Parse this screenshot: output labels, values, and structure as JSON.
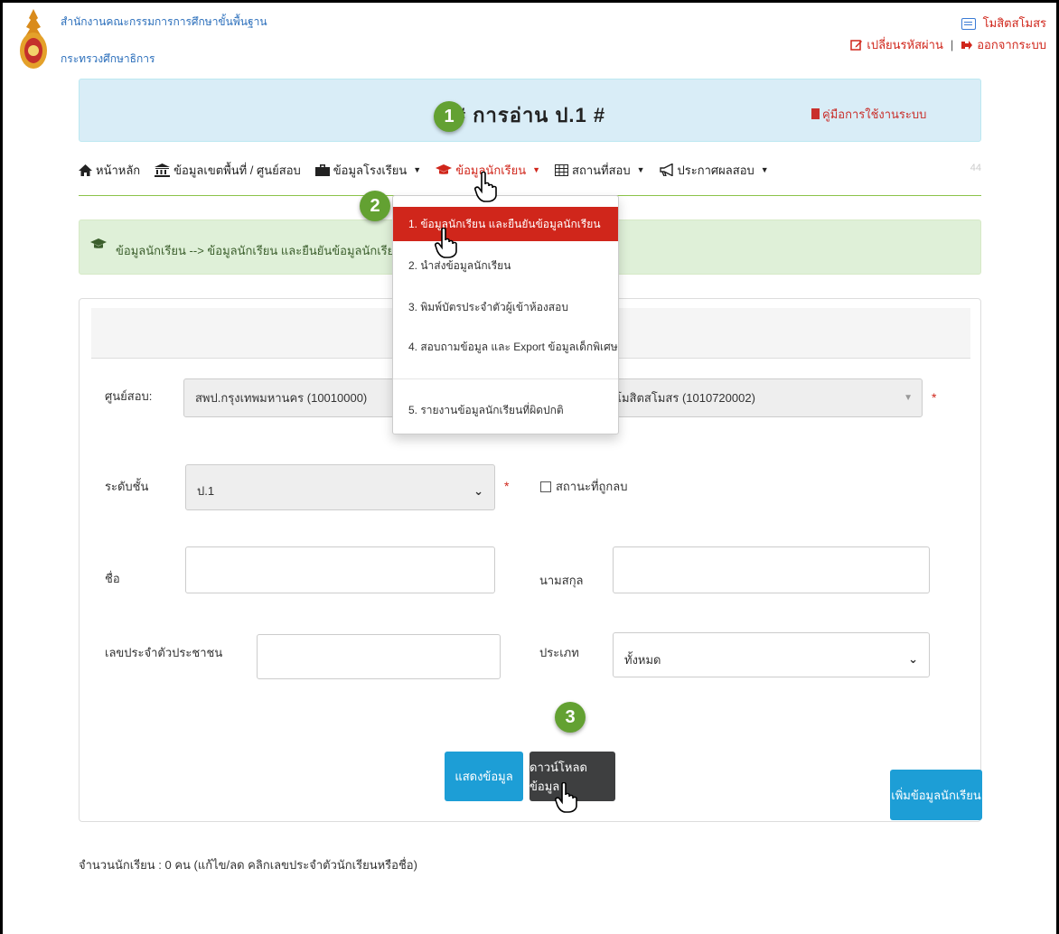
{
  "header": {
    "org_line1": "สำนักงานคณะกรรมการการศึกษาขั้นพื้นฐาน",
    "org_line2": "กระทรวงศึกษาธิการ",
    "user_name": "โมสิตสโมสร",
    "change_password": "เปลี่ยนรหัสผ่าน",
    "logout": "ออกจากระบบ",
    "separator": "|"
  },
  "banner": {
    "title": "# การอ่าน ป.1 #",
    "manual_link": "คู่มือการใช้งานระบบ"
  },
  "nav": {
    "items": [
      {
        "label": "หน้าหลัก",
        "icon": "home-icon"
      },
      {
        "label": "ข้อมูลเขตพื้นที่ / ศูนย์สอบ",
        "icon": "institution-icon"
      },
      {
        "label": "ข้อมูลโรงเรียน",
        "icon": "briefcase-icon"
      },
      {
        "label": "ข้อมูลนักเรียน",
        "icon": "graduation-cap-icon"
      },
      {
        "label": "สถานที่สอบ",
        "icon": "table-icon"
      },
      {
        "label": "ประกาศผลสอบ",
        "icon": "bullhorn-icon"
      }
    ],
    "count": "44"
  },
  "breadcrumb": "ข้อมูลนักเรียน --> ข้อมูลนักเรียน และยืนยันข้อมูลนักเรียน",
  "dropdown": {
    "items": [
      "1. ข้อมูลนักเรียน และยืนยันข้อมูลนักเรียน",
      "2. นำส่งข้อมูลนักเรียน",
      "3. พิมพ์บัตรประจำตัวผู้เข้าห้องสอบ",
      "4. สอบถามข้อมูล และ Export ข้อมูลเด็กพิเศษ",
      "5. รายงานข้อมูลนักเรียนที่ผิดปกติ"
    ]
  },
  "form": {
    "center_label": "ศูนย์สอบ:",
    "center_value": "สพป.กรุงเทพมหานคร (10010000)",
    "school_value": "โมสิตสโมสร (1010720002)",
    "level_label": "ระดับชั้น",
    "level_value": "ป.1",
    "venue_checkbox": "สถานะที่ถูกลบ",
    "first_name_label": "ชื่อ",
    "first_name_value": "",
    "last_name_label": "นามสกุล",
    "last_name_value": "",
    "id_label": "เลขประจำตัวประชาชน",
    "id_value": "",
    "type_label": "ประเภท",
    "type_value": "ทั้งหมด",
    "required_mark": "*"
  },
  "buttons": {
    "show": "แสดงข้อมูล",
    "download": "ดาวน์โหลดข้อมูล",
    "add": "เพิ่มข้อมูลนักเรียน"
  },
  "footer": {
    "count_text": "จำนวนนักเรียน : 0 คน (แก้ไข/ลด คลิกเลขประจำตัวนักเรียนหรือชื่อ)"
  },
  "markers": [
    "1",
    "2",
    "3"
  ],
  "colors": {
    "primary_red": "#d0261b",
    "info_blue": "#1d9ed6",
    "dark_button": "#3e3f40",
    "marker_green": "#63a132",
    "banner_bg": "#d9edf7",
    "breadcrumb_bg": "#dff0d8"
  }
}
